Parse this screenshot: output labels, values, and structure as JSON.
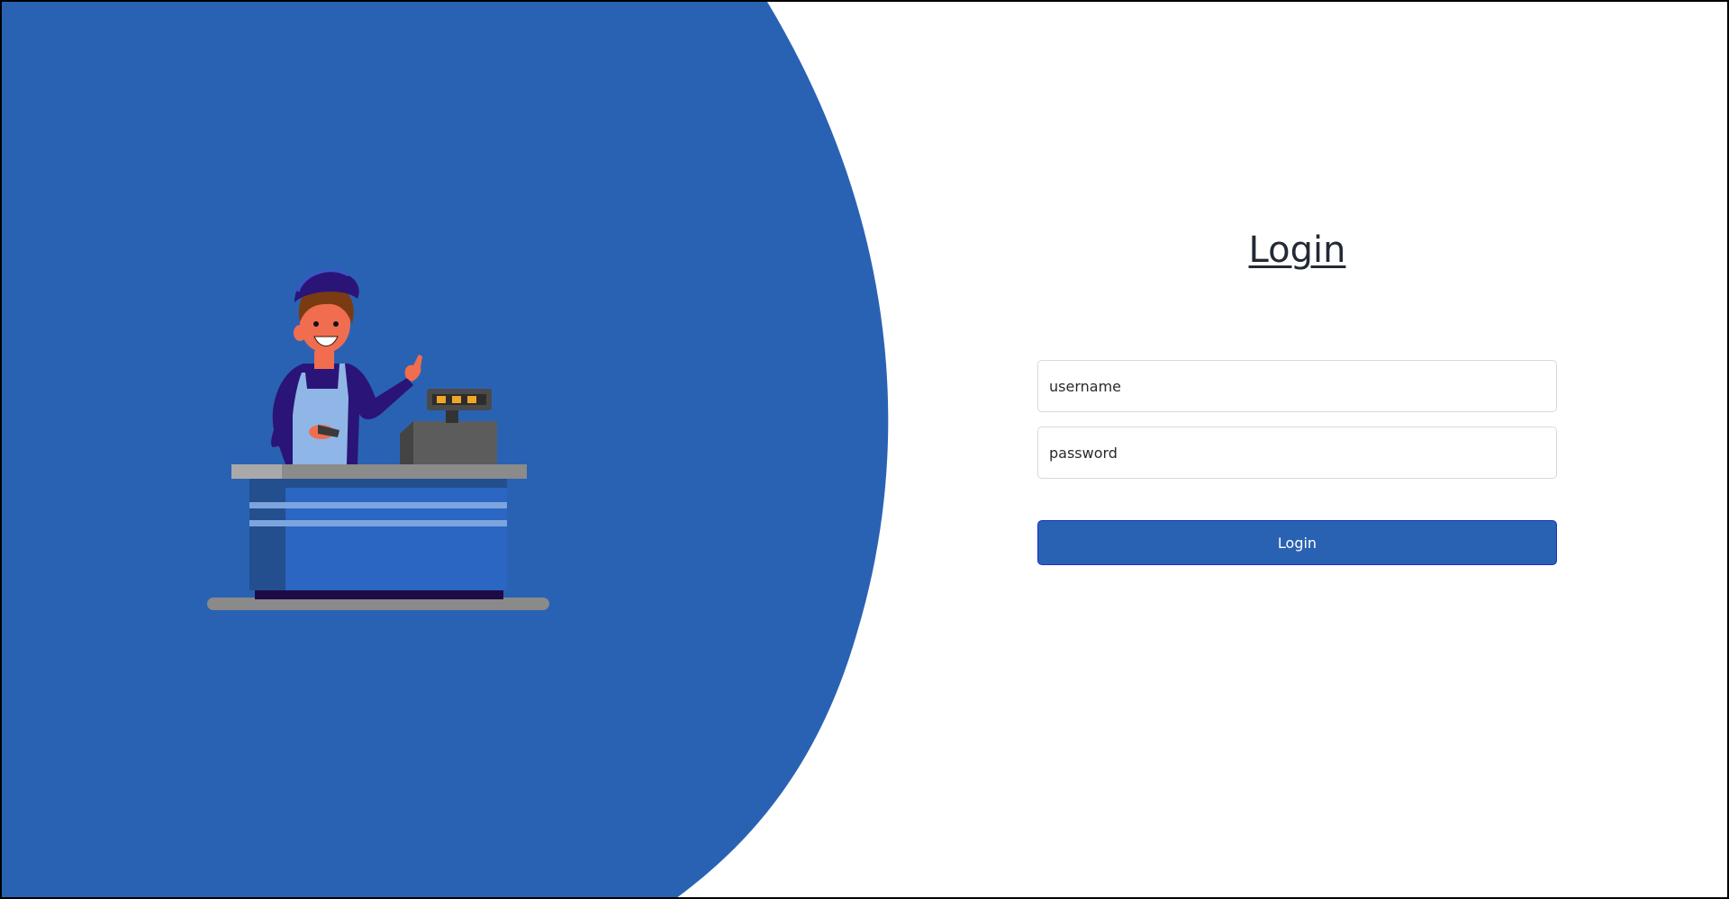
{
  "colors": {
    "brand_blue": "#2a62b3",
    "title_text": "#222a35",
    "button_border": "#1c2fc8",
    "input_border": "#d6d9dd"
  },
  "login": {
    "title": "Login",
    "username_placeholder": "username",
    "password_placeholder": "password",
    "button_label": "Login"
  },
  "illustration": {
    "icon": "cashier-at-checkout-counter-illustration"
  }
}
